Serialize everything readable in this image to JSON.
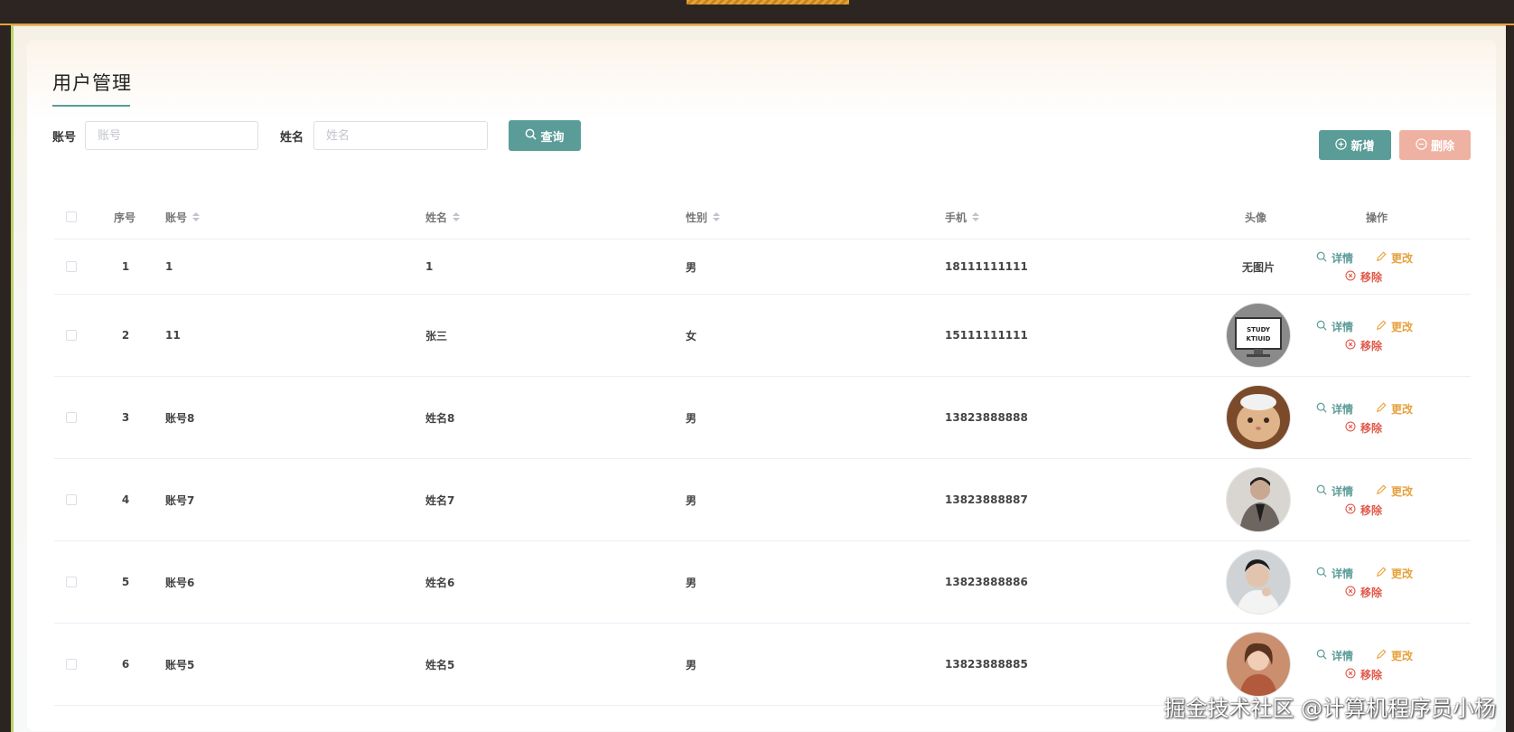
{
  "page": {
    "title": "用户管理"
  },
  "filters": {
    "account_label": "账号",
    "account_placeholder": "账号",
    "name_label": "姓名",
    "name_placeholder": "姓名",
    "query_button": "查询"
  },
  "actions": {
    "add_button": "新增",
    "delete_button": "删除"
  },
  "table": {
    "headers": {
      "index": "序号",
      "account": "账号",
      "name": "姓名",
      "gender": "性别",
      "phone": "手机",
      "avatar": "头像",
      "operations": "操作"
    },
    "row_actions": {
      "detail": "详情",
      "edit": "更改",
      "remove": "移除"
    },
    "rows": [
      {
        "index": "1",
        "account": "1",
        "name": "1",
        "gender": "男",
        "phone": "18111111111",
        "avatar": "无图片"
      },
      {
        "index": "2",
        "account": "11",
        "name": "张三",
        "gender": "女",
        "phone": "15111111111",
        "avatar": "study-monitor-image"
      },
      {
        "index": "3",
        "account": "账号8",
        "name": "姓名8",
        "gender": "男",
        "phone": "13823888888",
        "avatar": "cat-photo"
      },
      {
        "index": "4",
        "account": "账号7",
        "name": "姓名7",
        "gender": "男",
        "phone": "13823888887",
        "avatar": "man-portrait"
      },
      {
        "index": "5",
        "account": "账号6",
        "name": "姓名6",
        "gender": "男",
        "phone": "13823888886",
        "avatar": "man-portrait-2"
      },
      {
        "index": "6",
        "account": "账号5",
        "name": "姓名5",
        "gender": "男",
        "phone": "13823888885",
        "avatar": "woman-portrait"
      }
    ]
  },
  "watermark": "掘金技术社区 @计算机程序员小杨",
  "colors": {
    "primary": "#5a9c97",
    "danger_light": "#efb1a1",
    "warning": "#e6a23c",
    "danger": "#e05a4a"
  }
}
